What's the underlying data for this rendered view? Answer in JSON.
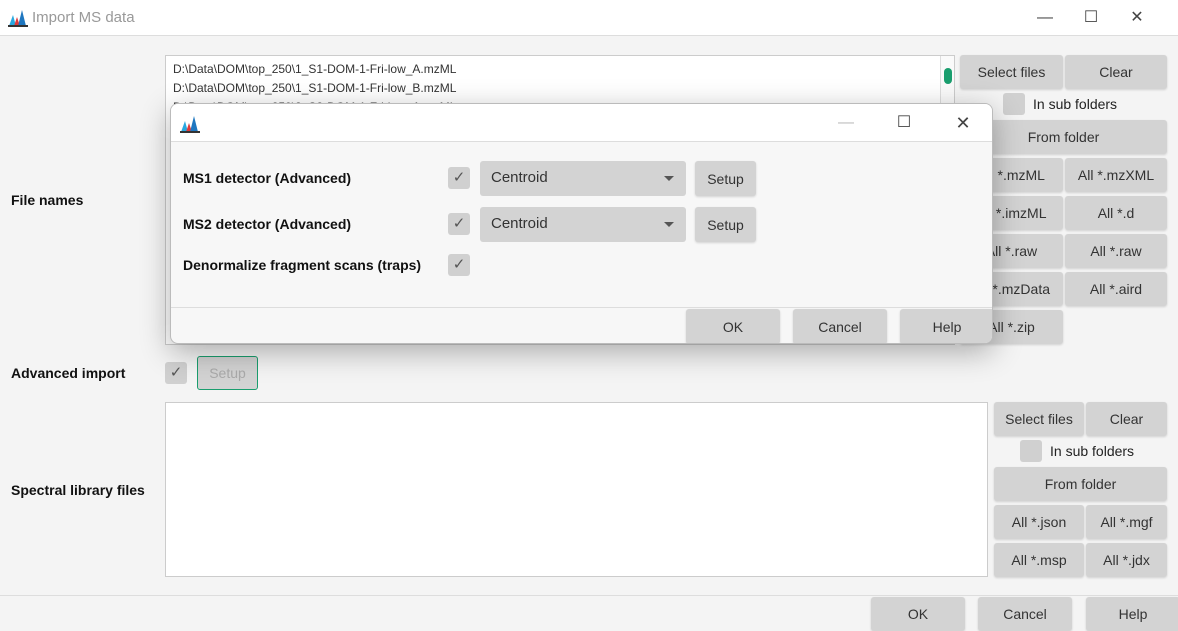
{
  "window": {
    "title": "Import MS data",
    "minimize": "—",
    "maximize": "☐",
    "close": "✕"
  },
  "main": {
    "file_names_label": "File names",
    "files": [
      "D:\\Data\\DOM\\top_250\\1_S1-DOM-1-Fri-low_A.mzML",
      "D:\\Data\\DOM\\top_250\\1_S1-DOM-1-Fri-low_B.mzML",
      "D:\\Data\\DOM\\top_250\\2_S2-DOM-1-Fri-low_A.mzML"
    ],
    "file_buttons": {
      "select": "Select files",
      "clear": "Clear",
      "subfolders": "In sub folders",
      "from_folder": "From folder",
      "grid": [
        "All *.mzML",
        "All *.mzXML",
        "All *.imzML",
        "All *.d",
        "All *.raw",
        "All *.raw",
        "All *.mzData",
        "All *.aird",
        "All *.zip"
      ]
    },
    "advanced_import_label": "Advanced import",
    "advanced_import_checked": true,
    "advanced_setup": "Setup",
    "spectral_label": "Spectral library files",
    "lib_buttons": {
      "select": "Select files",
      "clear": "Clear",
      "subfolders": "In sub folders",
      "from_folder": "From folder",
      "grid": [
        "All *.json",
        "All *.mgf",
        "All *.msp",
        "All *.jdx"
      ]
    },
    "ok": "OK",
    "cancel": "Cancel",
    "help": "Help"
  },
  "dialog": {
    "minimize": "—",
    "maximize": "☐",
    "close": "✕",
    "rows": [
      {
        "label": "MS1 detector (Advanced)",
        "checked": true,
        "value": "Centroid",
        "setup": "Setup"
      },
      {
        "label": "MS2 detector (Advanced)",
        "checked": true,
        "value": "Centroid",
        "setup": "Setup"
      },
      {
        "label": "Denormalize fragment scans (traps)",
        "checked": true
      }
    ],
    "check": "✓",
    "ok": "OK",
    "cancel": "Cancel",
    "help": "Help"
  },
  "colors": {
    "accent": "#1a9e6e",
    "scroll_thumb": "#1a9e6e"
  }
}
